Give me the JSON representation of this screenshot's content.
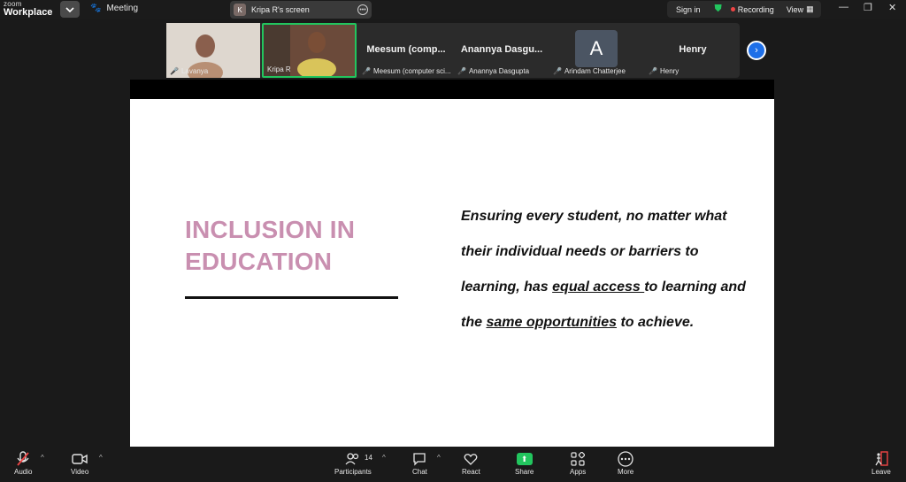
{
  "titlebar": {
    "logo_top": "zoom",
    "logo_bottom": "Workplace",
    "meeting_label": "Meeting",
    "screen_pill_initial": "K",
    "screen_pill_label": "Kripa R's screen",
    "sign_in": "Sign in",
    "recording": "Recording",
    "view": "View"
  },
  "participants": {
    "tiles": [
      {
        "name": "Lavanya",
        "big": ""
      },
      {
        "name": "Kripa R",
        "big": ""
      },
      {
        "name": "Meesum (computer sci...",
        "big": "Meesum (comp..."
      },
      {
        "name": "Anannya Dasgupta",
        "big": "Anannya Dasgu..."
      },
      {
        "name": "Arindam Chatterjee",
        "big": "A"
      },
      {
        "name": "Henry",
        "big": "Henry"
      }
    ]
  },
  "slide": {
    "title_line1": "INCLUSION IN",
    "title_line2": "EDUCATION",
    "body_1": "Ensuring every student, no matter what their individual needs or barriers to learning, has ",
    "body_u1": "equal access ",
    "body_2": "to learning and the ",
    "body_u2": "same opportunities",
    "body_3": " to achieve."
  },
  "toolbar": {
    "audio": "Audio",
    "video": "Video",
    "participants": "Participants",
    "participant_count": "14",
    "chat": "Chat",
    "react": "React",
    "share": "Share",
    "apps": "Apps",
    "more": "More",
    "leave": "Leave"
  },
  "colors": {
    "slide_title": "#c98fb0",
    "share_green": "#22c55e",
    "next_blue": "#1e6fe8",
    "recording_red": "#ef4444"
  }
}
